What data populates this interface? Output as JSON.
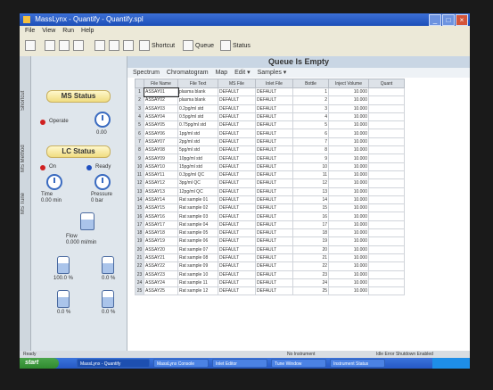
{
  "window": {
    "title": "MassLynx - Quantify - Quantify.spl"
  },
  "menu": [
    "File",
    "View",
    "Run",
    "Help"
  ],
  "toolbar": {
    "shortcut_label": "Shortcut",
    "queue_label": "Queue",
    "status_label": "Status"
  },
  "side_tabs": [
    "Shortcut",
    "MS Method",
    "MS Tune"
  ],
  "ms_status": {
    "header": "MS Status",
    "operate_label": "Operate",
    "gauge_value": "0.00"
  },
  "lc_status": {
    "header": "LC Status",
    "on_label": "On",
    "ready_label": "Ready",
    "time": "Time\n0.00 min",
    "pressure": "Pressure\n0 bar",
    "flow": "Flow\n0.000 ml/min",
    "bottles": [
      "100.0 %",
      "0.0 %",
      "0.0 %",
      "0.0 %"
    ]
  },
  "queue": {
    "header": "Queue Is Empty"
  },
  "tabs": [
    "Spectrum",
    "Chromatogram",
    "Map",
    "Edit ▾",
    "Samples ▾"
  ],
  "table": {
    "columns": [
      "",
      "File Name",
      "File Text",
      "MS File",
      "Inlet File",
      "Bottle",
      "Inject Volume",
      "Quant"
    ],
    "rows": [
      [
        "1",
        "ASSAY01",
        "plasma blank",
        "DEFAULT",
        "DEFAULT",
        "1",
        "10.000"
      ],
      [
        "2",
        "ASSAY02",
        "plasma blank",
        "DEFAULT",
        "DEFAULT",
        "2",
        "10.000"
      ],
      [
        "3",
        "ASSAY03",
        "0.2pg/ml std",
        "DEFAULT",
        "DEFAULT",
        "3",
        "10.000"
      ],
      [
        "4",
        "ASSAY04",
        "0.5pg/ml std",
        "DEFAULT",
        "DEFAULT",
        "4",
        "10.000"
      ],
      [
        "5",
        "ASSAY05",
        "0.75pg/ml std",
        "DEFAULT",
        "DEFAULT",
        "5",
        "10.000"
      ],
      [
        "6",
        "ASSAY06",
        "1pg/ml std",
        "DEFAULT",
        "DEFAULT",
        "6",
        "10.000"
      ],
      [
        "7",
        "ASSAY07",
        "2pg/ml std",
        "DEFAULT",
        "DEFAULT",
        "7",
        "10.000"
      ],
      [
        "8",
        "ASSAY08",
        "5pg/ml std",
        "DEFAULT",
        "DEFAULT",
        "8",
        "10.000"
      ],
      [
        "9",
        "ASSAY09",
        "10pg/ml std",
        "DEFAULT",
        "DEFAULT",
        "9",
        "10.000"
      ],
      [
        "10",
        "ASSAY10",
        "15pg/ml std",
        "DEFAULT",
        "DEFAULT",
        "10",
        "10.000"
      ],
      [
        "11",
        "ASSAY11",
        "0.3pg/ml QC",
        "DEFAULT",
        "DEFAULT",
        "11",
        "10.000"
      ],
      [
        "12",
        "ASSAY12",
        "3pg/ml QC",
        "DEFAULT",
        "DEFAULT",
        "12",
        "10.000"
      ],
      [
        "13",
        "ASSAY13",
        "12pg/ml QC",
        "DEFAULT",
        "DEFAULT",
        "13",
        "10.000"
      ],
      [
        "14",
        "ASSAY14",
        "Rat sample 01",
        "DEFAULT",
        "DEFAULT",
        "14",
        "10.000"
      ],
      [
        "15",
        "ASSAY15",
        "Rat sample 02",
        "DEFAULT",
        "DEFAULT",
        "15",
        "10.000"
      ],
      [
        "16",
        "ASSAY16",
        "Rat sample 03",
        "DEFAULT",
        "DEFAULT",
        "16",
        "10.000"
      ],
      [
        "17",
        "ASSAY17",
        "Rat sample 04",
        "DEFAULT",
        "DEFAULT",
        "17",
        "10.000"
      ],
      [
        "18",
        "ASSAY18",
        "Rat sample 05",
        "DEFAULT",
        "DEFAULT",
        "18",
        "10.000"
      ],
      [
        "19",
        "ASSAY19",
        "Rat sample 06",
        "DEFAULT",
        "DEFAULT",
        "19",
        "10.000"
      ],
      [
        "20",
        "ASSAY20",
        "Rat sample 07",
        "DEFAULT",
        "DEFAULT",
        "20",
        "10.000"
      ],
      [
        "21",
        "ASSAY21",
        "Rat sample 08",
        "DEFAULT",
        "DEFAULT",
        "21",
        "10.000"
      ],
      [
        "22",
        "ASSAY22",
        "Rat sample 09",
        "DEFAULT",
        "DEFAULT",
        "22",
        "10.000"
      ],
      [
        "23",
        "ASSAY23",
        "Rat sample 10",
        "DEFAULT",
        "DEFAULT",
        "23",
        "10.000"
      ],
      [
        "24",
        "ASSAY24",
        "Rat sample 11",
        "DEFAULT",
        "DEFAULT",
        "24",
        "10.000"
      ],
      [
        "25",
        "ASSAY25",
        "Rat sample 12",
        "DEFAULT",
        "DEFAULT",
        "25",
        "10.000"
      ]
    ]
  },
  "statusbar": {
    "left": "Ready",
    "middle": "No Instrument",
    "right": "Idle  Error Shutdown Enabled"
  },
  "taskbar": {
    "start_label": "start",
    "items": [
      "MassLynx - Quantify",
      "MassLynx Console",
      "Inlet Editor",
      "Tune Window",
      "Instrument Status"
    ]
  },
  "colors": {
    "accent": "#3a6bc0",
    "status_red": "#d02020",
    "status_blue": "#2050c0"
  }
}
